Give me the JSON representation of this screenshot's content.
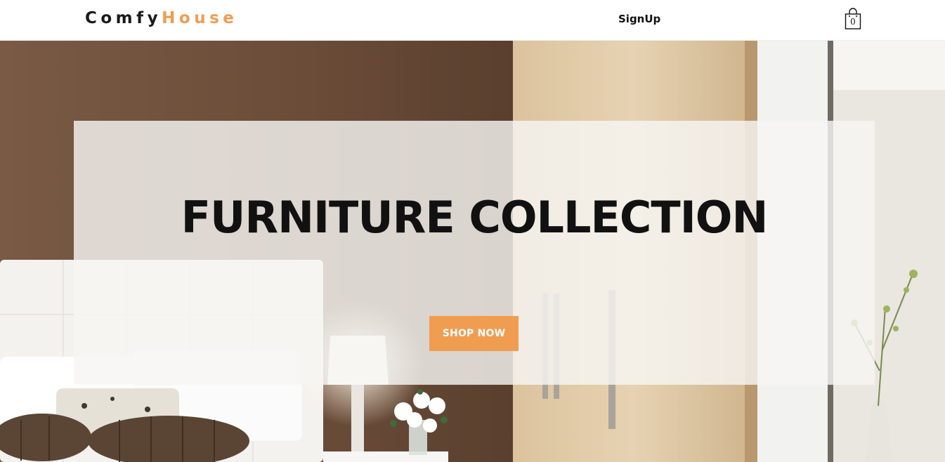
{
  "navbar": {
    "logo": {
      "part1": "Comfy",
      "part2": "House"
    },
    "signup_label": "SignUp",
    "cart": {
      "icon": "shopping-bag-icon",
      "count": "0"
    }
  },
  "hero": {
    "title": "FURNITURE COLLECTION",
    "button_label": "SHOP NOW"
  },
  "colors": {
    "accent": "#f09d51",
    "text": "#111111",
    "navbar_bg": "#ffffff"
  }
}
